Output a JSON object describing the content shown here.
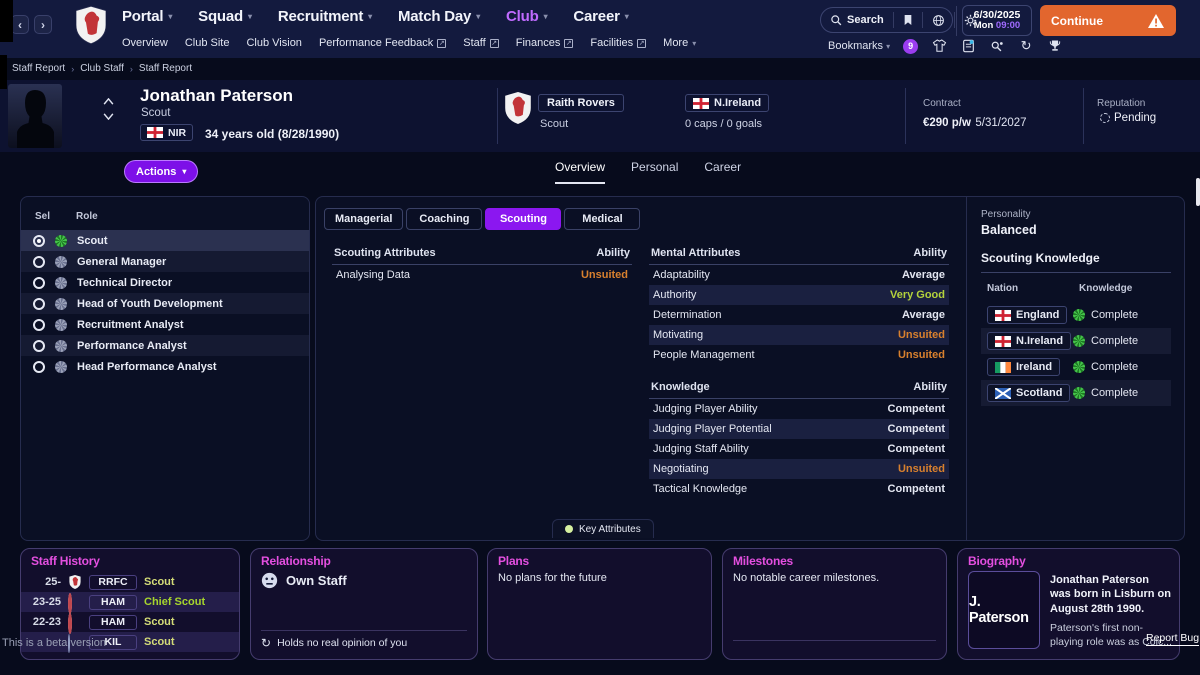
{
  "icons": {
    "caret": "▾",
    "back": "‹",
    "forward": "›",
    "external": "↗",
    "sync": "↻",
    "history": "↻"
  },
  "colors": {
    "accent_purple": "#8b17f0",
    "magenta": "#e44fe0",
    "continue_orange": "#e2662e",
    "unsuited": "#d8802e",
    "very_good": "#b4d23c",
    "complete_green": "#44c44a"
  },
  "chrome": {
    "nav_main": [
      {
        "label": "Portal",
        "active": false
      },
      {
        "label": "Squad",
        "active": false
      },
      {
        "label": "Recruitment",
        "active": false
      },
      {
        "label": "Match Day",
        "active": false
      },
      {
        "label": "Club",
        "active": true
      },
      {
        "label": "Career",
        "active": false
      }
    ],
    "nav_sub": [
      {
        "label": "Overview",
        "external": false,
        "caret": false
      },
      {
        "label": "Club Site",
        "external": false,
        "caret": false
      },
      {
        "label": "Club Vision",
        "external": false,
        "caret": false
      },
      {
        "label": "Performance Feedback",
        "external": true,
        "caret": false
      },
      {
        "label": "Staff",
        "external": true,
        "caret": false
      },
      {
        "label": "Finances",
        "external": true,
        "caret": false
      },
      {
        "label": "Facilities",
        "external": true,
        "caret": false
      },
      {
        "label": "More",
        "external": false,
        "caret": true
      }
    ],
    "search_label": "Search",
    "date": {
      "date": "6/30/2025",
      "day": "Mon",
      "time": "09:00"
    },
    "continue_label": "Continue",
    "bookmarks_label": "Bookmarks",
    "notification_count": "9"
  },
  "breadcrumb": [
    "Staff Report",
    "Club Staff",
    "Staff Report"
  ],
  "header": {
    "name": "Jonathan Paterson",
    "role": "Scout",
    "nationality_code": "NIR",
    "age_text": "34 years old (8/28/1990)",
    "club_name": "Raith Rovers",
    "club_role": "Scout",
    "national_team": "N.Ireland",
    "caps_text": "0 caps / 0 goals",
    "contract_label": "Contract",
    "contract_wage": "€290 p/w",
    "contract_expiry": "5/31/2027",
    "reputation_label": "Reputation",
    "reputation_value": "Pending",
    "actions_label": "Actions",
    "tabs": [
      {
        "label": "Overview",
        "active": true
      },
      {
        "label": "Personal",
        "active": false
      },
      {
        "label": "Career",
        "active": false
      }
    ]
  },
  "roles_panel": {
    "col_sel": "Sel",
    "col_role": "Role",
    "rows": [
      {
        "label": "Scout",
        "selected": true,
        "icon_tone": "green"
      },
      {
        "label": "General Manager",
        "selected": false,
        "icon_tone": "gray"
      },
      {
        "label": "Technical Director",
        "selected": false,
        "icon_tone": "gray"
      },
      {
        "label": "Head of Youth Development",
        "selected": false,
        "icon_tone": "gray"
      },
      {
        "label": "Recruitment Analyst",
        "selected": false,
        "icon_tone": "gray"
      },
      {
        "label": "Performance Analyst",
        "selected": false,
        "icon_tone": "gray"
      },
      {
        "label": "Head Performance Analyst",
        "selected": false,
        "icon_tone": "gray"
      }
    ]
  },
  "attributes_panel": {
    "tabs": [
      {
        "label": "Managerial",
        "active": false
      },
      {
        "label": "Coaching",
        "active": false
      },
      {
        "label": "Scouting",
        "active": true
      },
      {
        "label": "Medical",
        "active": false
      }
    ],
    "ability_label": "Ability",
    "scouting_title": "Scouting Attributes",
    "scouting_rows": [
      {
        "name": "Analysing Data",
        "value": "Unsuited",
        "tone": "unsuited"
      }
    ],
    "mental_title": "Mental Attributes",
    "mental_rows": [
      {
        "name": "Adaptability",
        "value": "Average",
        "tone": "normal"
      },
      {
        "name": "Authority",
        "value": "Very Good",
        "tone": "good"
      },
      {
        "name": "Determination",
        "value": "Average",
        "tone": "normal"
      },
      {
        "name": "Motivating",
        "value": "Unsuited",
        "tone": "unsuited"
      },
      {
        "name": "People Management",
        "value": "Unsuited",
        "tone": "unsuited"
      }
    ],
    "knowledge_title": "Knowledge",
    "knowledge_rows": [
      {
        "name": "Judging Player Ability",
        "value": "Competent",
        "tone": "normal"
      },
      {
        "name": "Judging Player Potential",
        "value": "Competent",
        "tone": "normal"
      },
      {
        "name": "Judging Staff Ability",
        "value": "Competent",
        "tone": "normal"
      },
      {
        "name": "Negotiating",
        "value": "Unsuited",
        "tone": "unsuited"
      },
      {
        "name": "Tactical Knowledge",
        "value": "Competent",
        "tone": "normal"
      }
    ],
    "key_attributes_label": "Key Attributes"
  },
  "profile_panel": {
    "personality_label": "Personality",
    "personality_value": "Balanced",
    "scouting_knowledge_title": "Scouting Knowledge",
    "col_nation": "Nation",
    "col_knowledge": "Knowledge",
    "rows": [
      {
        "nation": "England",
        "flag": "england",
        "value": "Complete"
      },
      {
        "nation": "N.Ireland",
        "flag": "nireland",
        "value": "Complete"
      },
      {
        "nation": "Ireland",
        "flag": "ireland",
        "value": "Complete"
      },
      {
        "nation": "Scotland",
        "flag": "scotland",
        "value": "Complete"
      }
    ]
  },
  "cards": {
    "staff_history": {
      "title": "Staff History",
      "rows": [
        {
          "years": "25-",
          "club": "RRFC",
          "badge": "rrfc",
          "role": "Scout",
          "role_tone": "scout"
        },
        {
          "years": "23-25",
          "club": "HAM",
          "badge": "ham",
          "role": "Chief Scout",
          "role_tone": "chief"
        },
        {
          "years": "22-23",
          "club": "HAM",
          "badge": "ham",
          "role": "Scout",
          "role_tone": "scout"
        },
        {
          "years": "",
          "club": "KIL",
          "badge": "kil",
          "role": "Scout",
          "role_tone": "scout"
        }
      ]
    },
    "relationship": {
      "title": "Relationship",
      "status": "Own Staff",
      "note": "Holds no real opinion of you"
    },
    "plans": {
      "title": "Plans",
      "text": "No plans for the future"
    },
    "milestones": {
      "title": "Milestones",
      "text": "No notable career milestones."
    },
    "biography": {
      "title": "Biography",
      "card_name": "J. Paterson",
      "text_bold": "Jonathan Paterson was born in Lisburn on August 28th 1990.",
      "text_more": "Paterson's first non-playing role was as Colc..."
    }
  },
  "footer": {
    "watermark": "This is a beta version",
    "report_bug": "Report Bug"
  }
}
